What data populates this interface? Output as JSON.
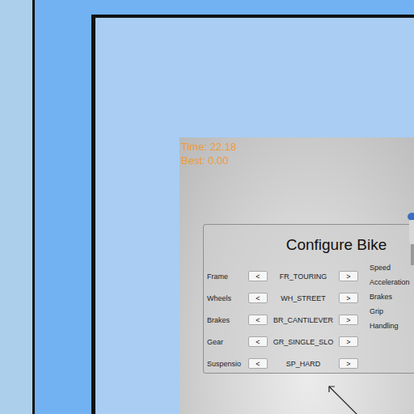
{
  "hud": {
    "time": "Time: 22.18",
    "best": "Best: 0.00"
  },
  "panel": {
    "title": "Configure Bike",
    "options": [
      {
        "label": "Frame",
        "prev": "<",
        "value": "FR_TOURING",
        "next": ">"
      },
      {
        "label": "Wheels",
        "prev": "<",
        "value": "WH_STREET",
        "next": ">"
      },
      {
        "label": "Brakes",
        "prev": "<",
        "value": "BR_CANTILEVER",
        "next": ">"
      },
      {
        "label": "Gear",
        "prev": "<",
        "value": "GR_SINGLE_SLO",
        "next": ">"
      },
      {
        "label": "Suspensio",
        "prev": "<",
        "value": "SP_HARD",
        "next": ">"
      }
    ],
    "stats": [
      "Speed",
      "Acceleration",
      "Brakes",
      "Grip",
      "Handling"
    ]
  }
}
